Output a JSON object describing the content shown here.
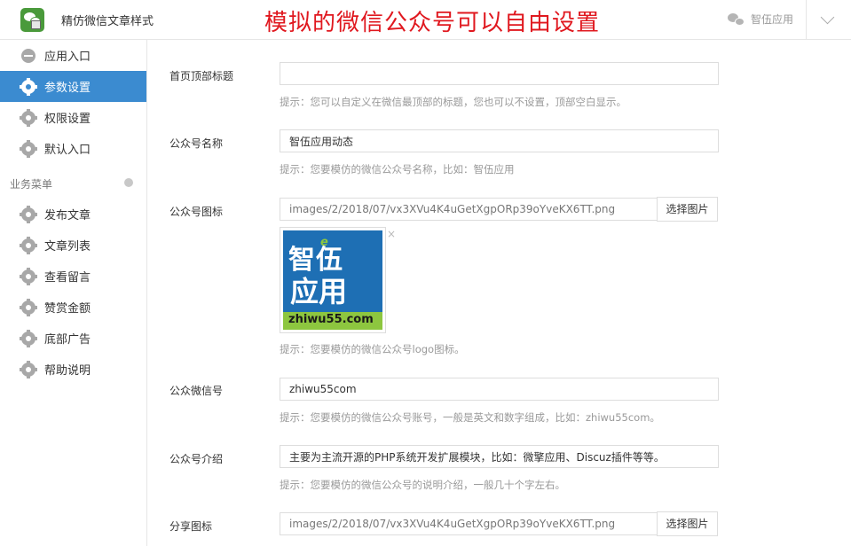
{
  "header": {
    "app_title": "精仿微信文章样式",
    "banner": "模拟的微信公众号可以自由设置",
    "brand": "智伍应用"
  },
  "sidebar": {
    "items": [
      {
        "label": "应用入口",
        "icon": "chat-icon"
      },
      {
        "label": "参数设置",
        "icon": "gear-icon",
        "active": true
      },
      {
        "label": "权限设置",
        "icon": "gear-icon"
      },
      {
        "label": "默认入口",
        "icon": "gear-icon"
      }
    ],
    "section_title": "业务菜单",
    "section_items": [
      {
        "label": "发布文章"
      },
      {
        "label": "文章列表"
      },
      {
        "label": "查看留言"
      },
      {
        "label": "赞赏金额"
      },
      {
        "label": "底部广告"
      },
      {
        "label": "帮助说明"
      }
    ]
  },
  "form": {
    "top_title": {
      "label": "首页顶部标题",
      "value": "",
      "hint": "提示：您可以自定义在微信最顶部的标题，您也可以不设置，顶部空白显示。"
    },
    "account_name": {
      "label": "公众号名称",
      "value": "智伍应用动态",
      "hint": "提示：您要模仿的微信公众号名称，比如：智伍应用"
    },
    "account_icon": {
      "label": "公众号图标",
      "value": "images/2/2018/07/vx3XVu4K4uGetXgpORp39oYveKX6TT.png",
      "button": "选择图片",
      "preview_text_1": "智伍",
      "preview_text_2": "应用",
      "preview_e": "e",
      "preview_url": "zhiwu55.com",
      "close": "×",
      "hint": "提示：您要模仿的微信公众号logo图标。"
    },
    "wechat_id": {
      "label": "公众微信号",
      "value": "zhiwu55com",
      "hint": "提示：您要模仿的微信公众号账号，一般是英文和数字组成，比如：zhiwu55com。"
    },
    "intro": {
      "label": "公众号介绍",
      "value": "主要为主流开源的PHP系统开发扩展模块，比如：微擎应用、Discuz插件等等。",
      "hint": "提示：您要模仿的微信公众号的说明介绍，一般几十个字左右。"
    },
    "share_icon": {
      "label": "分享图标",
      "value": "images/2/2018/07/vx3XVu4K4uGetXgpORp39oYveKX6TT.png",
      "button": "选择图片"
    }
  },
  "colors": {
    "accent": "#3b8bd0",
    "banner": "#e0181f"
  }
}
